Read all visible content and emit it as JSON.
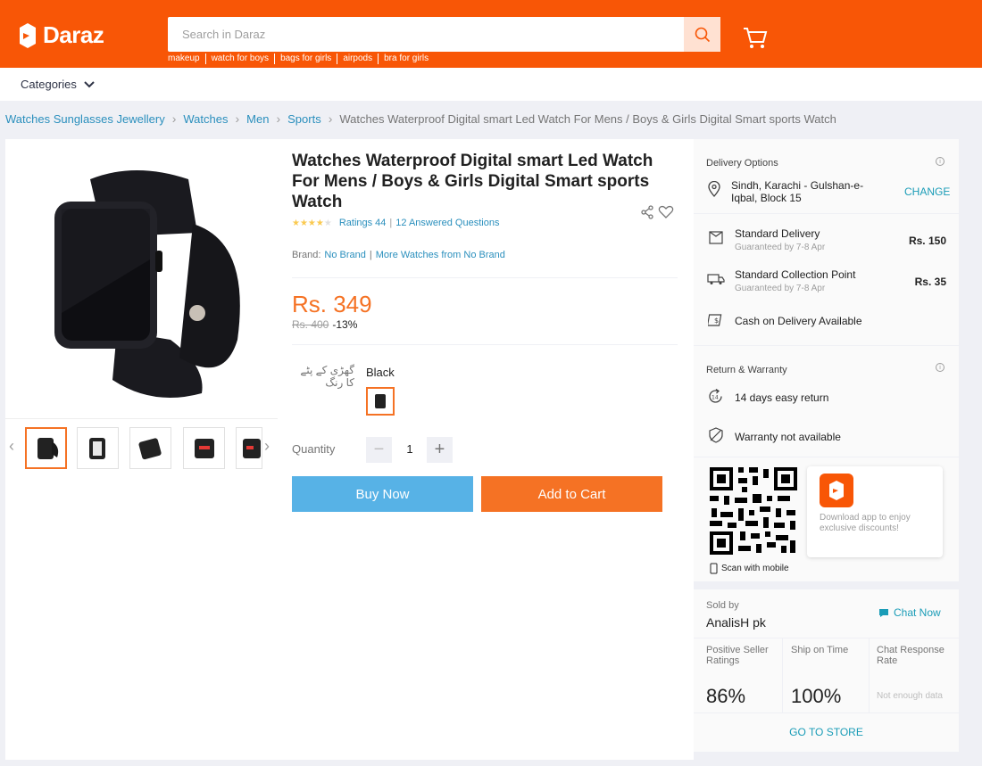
{
  "header": {
    "logo_text": "Daraz",
    "search_placeholder": "Search in Daraz",
    "suggestions": [
      "makeup",
      "watch for boys",
      "bags for girls",
      "airpods",
      "bra for girls"
    ],
    "brand_color": "#f85606"
  },
  "nav": {
    "categories_label": "Categories"
  },
  "breadcrumb": {
    "items": [
      "Watches Sunglasses Jewellery",
      "Watches",
      "Men",
      "Sports"
    ],
    "current": "Watches Waterproof Digital smart Led Watch For Mens / Boys & Girls Digital Smart sports Watch"
  },
  "product": {
    "title": "Watches Waterproof Digital smart Led Watch For Mens / Boys & Girls Digital Smart sports Watch",
    "rating_stars": 4,
    "ratings_text": "Ratings 44",
    "questions_text": "12 Answered Questions",
    "brand_label": "Brand:",
    "brand_value": "No Brand",
    "more_from": "More Watches from No Brand",
    "price": "Rs. 349",
    "original_price": "Rs. 400",
    "discount": "-13%",
    "variant_label": "گھڑی کے پٹے کا رنگ",
    "variant_value": "Black",
    "quantity_label": "Quantity",
    "quantity": "1",
    "buy_now": "Buy Now",
    "add_to_cart": "Add to Cart"
  },
  "delivery": {
    "heading": "Delivery Options",
    "location": "Sindh, Karachi - Gulshan-e-Iqbal, Block 15",
    "change": "CHANGE",
    "options": [
      {
        "name": "Standard Delivery",
        "eta": "Guaranteed by 7-8 Apr",
        "price": "Rs. 150"
      },
      {
        "name": "Standard Collection Point",
        "eta": "Guaranteed by 7-8 Apr",
        "price": "Rs. 35"
      }
    ],
    "cod": "Cash on Delivery Available"
  },
  "warranty": {
    "heading": "Return & Warranty",
    "return": "14 days easy return",
    "warranty": "Warranty not available"
  },
  "app": {
    "promo": "Download app to enjoy exclusive discounts!",
    "scan": "Scan with mobile"
  },
  "seller": {
    "label": "Sold by",
    "name": "AnalisH pk",
    "chat": "Chat Now",
    "metrics": [
      {
        "title": "Positive Seller Ratings",
        "value": "86%"
      },
      {
        "title": "Ship on Time",
        "value": "100%"
      },
      {
        "title": "Chat Response Rate",
        "value": "Not enough data"
      }
    ],
    "go_store": "GO TO STORE"
  }
}
